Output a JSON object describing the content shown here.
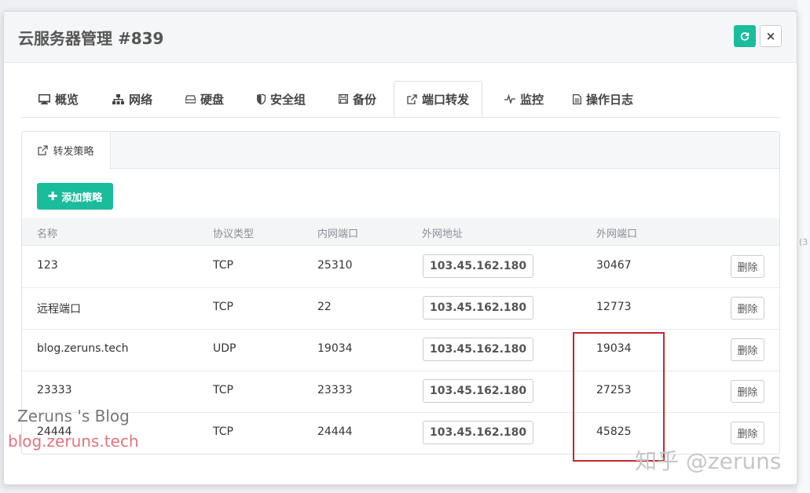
{
  "modal": {
    "title": "云服务器管理 #839",
    "refresh_icon": "refresh-icon",
    "close_label": "×"
  },
  "tabs": [
    {
      "label": "概览",
      "icon": "monitor-icon"
    },
    {
      "label": "网络",
      "icon": "network-icon"
    },
    {
      "label": "硬盘",
      "icon": "hdd-icon"
    },
    {
      "label": "安全组",
      "icon": "shield-icon"
    },
    {
      "label": "备份",
      "icon": "save-icon"
    },
    {
      "label": "端口转发",
      "icon": "external-link-icon",
      "active": true
    },
    {
      "label": "监控",
      "icon": "heartbeat-icon"
    },
    {
      "label": "操作日志",
      "icon": "file-icon"
    }
  ],
  "panel": {
    "subtab_label": "转发策略",
    "add_button_label": "添加策略",
    "columns": [
      "名称",
      "协议类型",
      "内网端口",
      "外网地址",
      "外网端口"
    ],
    "rows": [
      {
        "name": "123",
        "protocol": "TCP",
        "internal_port": "25310",
        "external_ip": "103.45.162.180",
        "external_port": "30467",
        "action": "删除"
      },
      {
        "name": "远程端口",
        "protocol": "TCP",
        "internal_port": "22",
        "external_ip": "103.45.162.180",
        "external_port": "12773",
        "action": "删除"
      },
      {
        "name": "blog.zeruns.tech",
        "protocol": "UDP",
        "internal_port": "19034",
        "external_ip": "103.45.162.180",
        "external_port": "19034",
        "action": "删除"
      },
      {
        "name": "23333",
        "protocol": "TCP",
        "internal_port": "23333",
        "external_ip": "103.45.162.180",
        "external_port": "27253",
        "action": "删除"
      },
      {
        "name": "24444",
        "protocol": "TCP",
        "internal_port": "24444",
        "external_ip": "103.45.162.180",
        "external_port": "45825",
        "action": "删除"
      }
    ]
  },
  "watermarks": {
    "blog_title": "Zeruns 's Blog",
    "blog_url": "blog.zeruns.tech",
    "zhihu": "知乎 @zeruns"
  },
  "background": {
    "edge_text": "(3"
  },
  "colors": {
    "accent": "#1abc9c",
    "highlight_box": "#c0282d"
  }
}
